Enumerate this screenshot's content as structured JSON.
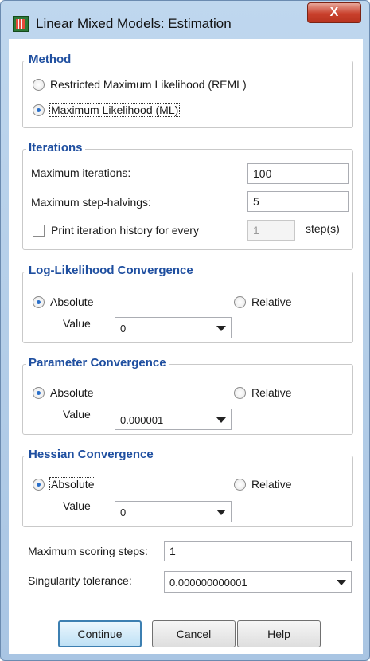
{
  "window": {
    "title": "Linear Mixed Models: Estimation",
    "close_label": "X",
    "app_icon": "spss-table-icon"
  },
  "method": {
    "legend": "Method",
    "reml_label": "Restricted Maximum Likelihood (REML)",
    "ml_label": "Maximum Likelihood (ML)",
    "selected": "ml"
  },
  "iterations": {
    "legend": "Iterations",
    "max_iterations_label": "Maximum iterations:",
    "max_iterations_value": "100",
    "max_step_halvings_label": "Maximum step-halvings:",
    "max_step_halvings_value": "5",
    "print_history_label": "Print iteration history for every",
    "print_history_checked": false,
    "print_history_value": "1",
    "steps_label": "step(s)"
  },
  "loglik": {
    "legend": "Log-Likelihood Convergence",
    "absolute_label": "Absolute",
    "relative_label": "Relative",
    "selected": "absolute",
    "value_label": "Value",
    "value": "0"
  },
  "parameter": {
    "legend": "Parameter Convergence",
    "absolute_label": "Absolute",
    "relative_label": "Relative",
    "selected": "absolute",
    "value_label": "Value",
    "value": "0.000001"
  },
  "hessian": {
    "legend": "Hessian Convergence",
    "absolute_label": "Absolute",
    "relative_label": "Relative",
    "selected": "absolute",
    "value_label": "Value",
    "value": "0"
  },
  "scoring": {
    "label": "Maximum scoring steps:",
    "value": "1"
  },
  "singularity": {
    "label": "Singularity tolerance:",
    "value": "0.000000000001"
  },
  "buttons": {
    "continue": "Continue",
    "cancel": "Cancel",
    "help": "Help"
  },
  "colors": {
    "legend": "#1f4fa0",
    "radio_selected": "#2a6fc9",
    "close_button": "#c9402c"
  }
}
